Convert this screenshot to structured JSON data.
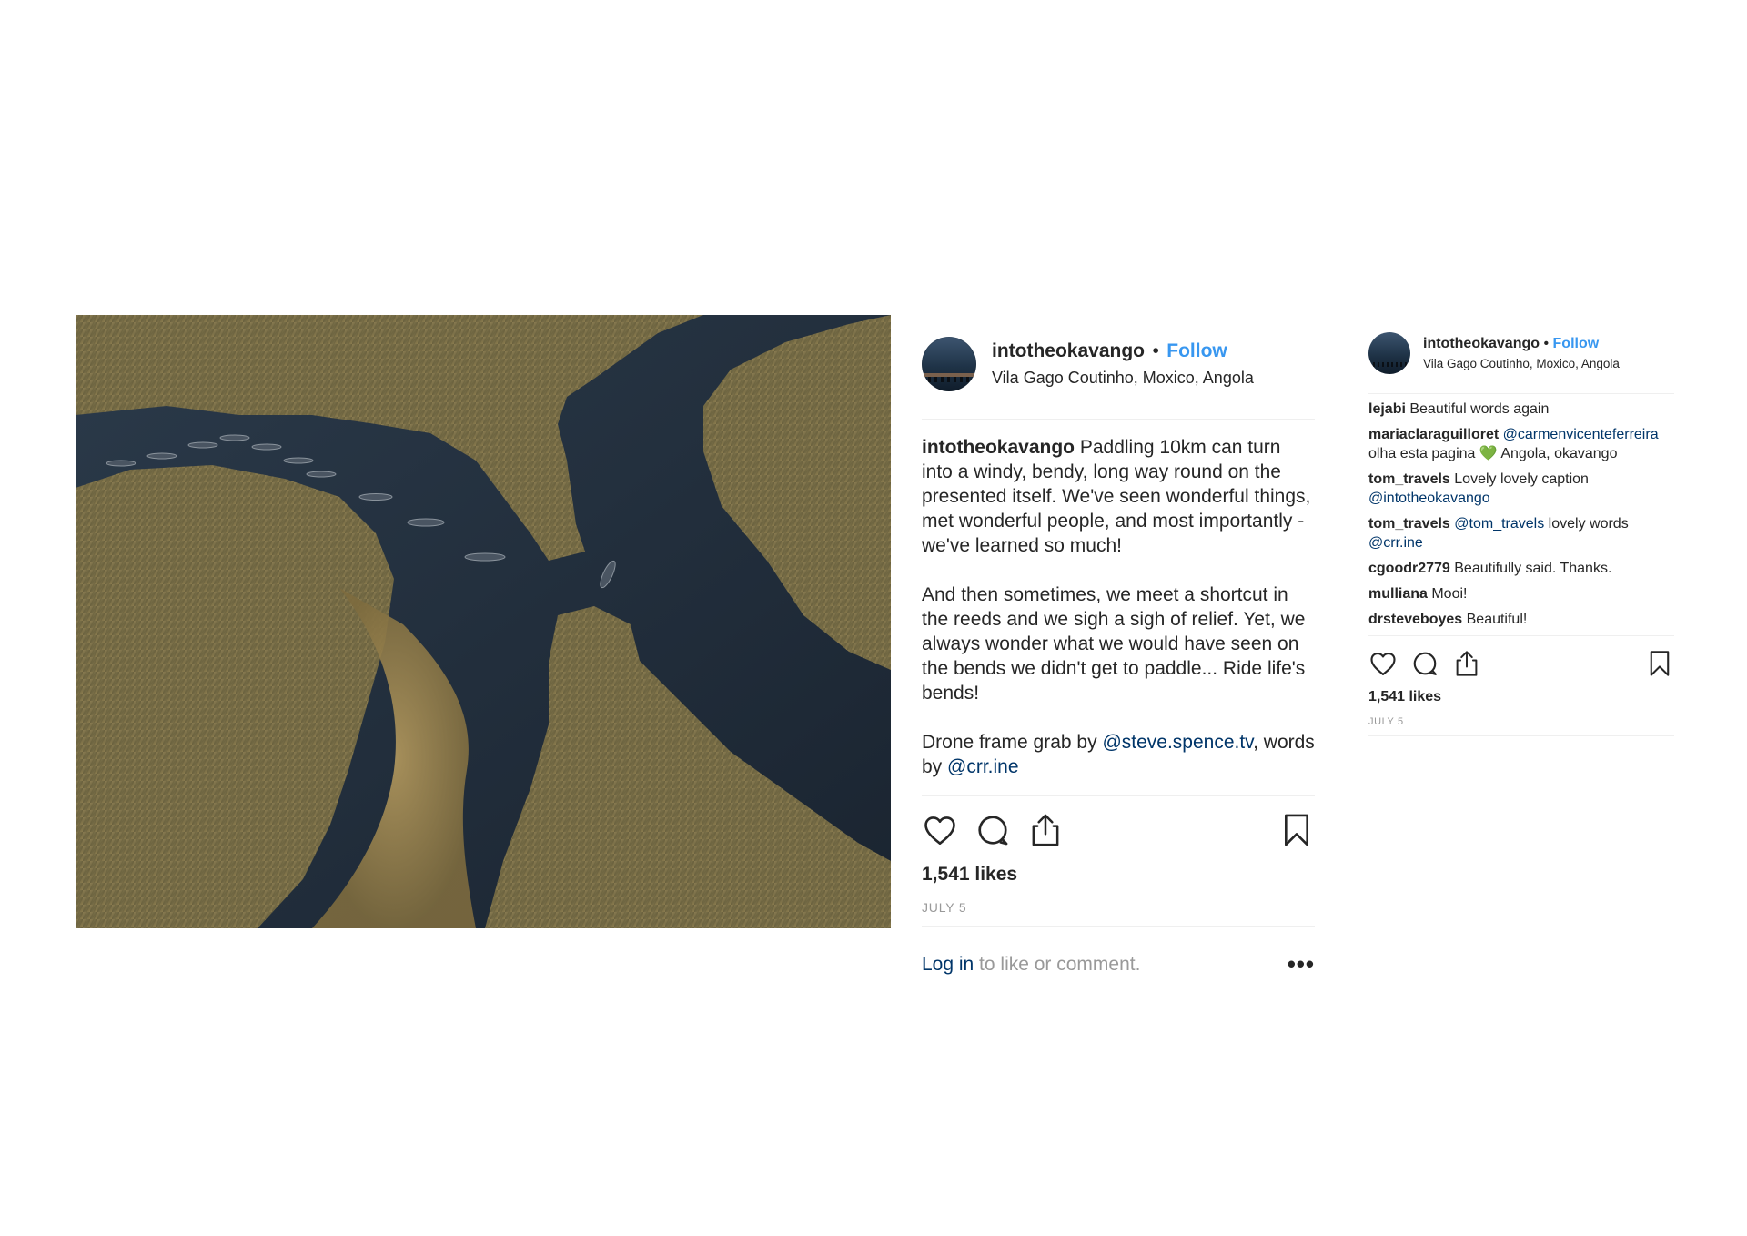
{
  "post": {
    "username": "intotheokavango",
    "separator": "•",
    "follow_label": "Follow",
    "location": "Vila Gago Coutinho, Moxico, Angola",
    "caption_username": "intotheokavango",
    "caption_p1": " Paddling 10km can turn into a windy, bendy, long way round on the presented itself. We've seen wonderful things, met wonderful people, and most importantly - we've learned so much!",
    "caption_p2": "And then sometimes, we meet a shortcut in the reeds and we sigh a sigh of relief. Yet, we always wonder what we would have seen on the bends we didn't get to paddle... Ride life's bends!",
    "caption_p3_prefix": "Drone frame grab by ",
    "caption_p3_mention1": "@steve.spence.tv",
    "caption_p3_mid": ", words by ",
    "caption_p3_mention2": "@crr.ine",
    "likes": "1,541 likes",
    "date": "JULY 5",
    "login_link": "Log in",
    "login_text": " to like or comment.",
    "more_label": "•••",
    "icons": [
      "heart-icon",
      "comment-icon",
      "share-icon",
      "bookmark-icon",
      "more-icon"
    ]
  },
  "post_small": {
    "username": "intotheokavango",
    "separator": "•",
    "follow_label": "Follow",
    "location": "Vila Gago Coutinho, Moxico, Angola",
    "comments": [
      {
        "user": "lejabi",
        "text": " Beautiful words again",
        "mention": ""
      },
      {
        "user": "mariaclaraguilloret",
        "mention": " @carmenvicenteferreira",
        "text": " olha esta pagina 💚 Angola, okavango"
      },
      {
        "user": "tom_travels",
        "text": " Lovely lovely caption ",
        "mention": "@intotheokavango"
      },
      {
        "user": "tom_travels",
        "mention": " @tom_travels",
        "text": " lovely words ",
        "mention2": "@crr.ine"
      },
      {
        "user": "cgoodr2779",
        "text": " Beautifully said. Thanks.",
        "mention": ""
      },
      {
        "user": "mulliana",
        "text": " Mooi!",
        "mention": ""
      },
      {
        "user": "drsteveboyes",
        "text": " Beautiful!",
        "mention": ""
      }
    ],
    "likes": "1,541 likes",
    "date": "JULY 5"
  },
  "colors": {
    "follow": "#3897f0",
    "mention": "#003569",
    "text": "#262626",
    "muted": "#999999",
    "divider": "#efefef"
  }
}
